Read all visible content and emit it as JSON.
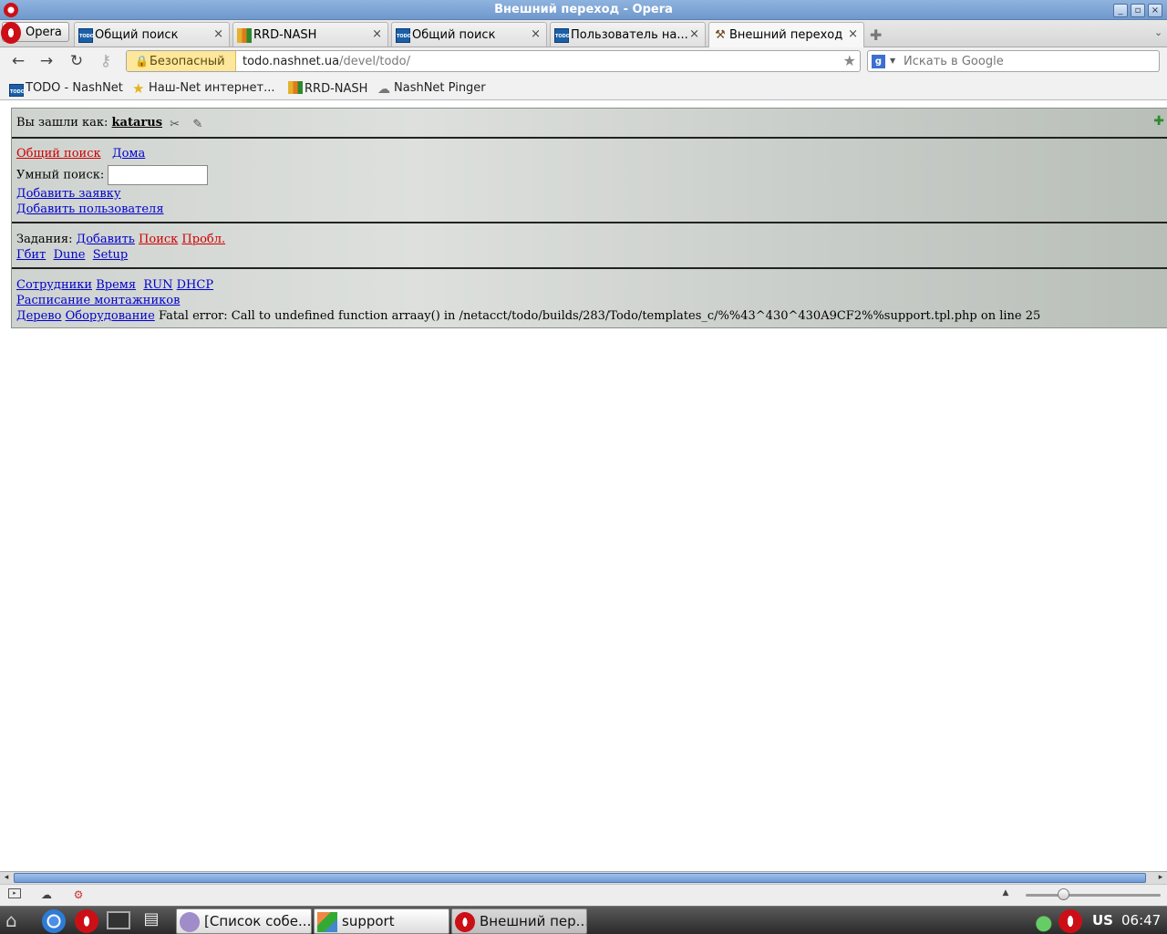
{
  "window": {
    "title": "Внешний переход - Opera"
  },
  "tabbar": {
    "menu_label": "Opera",
    "tabs": [
      {
        "label": "Общий поиск",
        "icon": "todo-favicon"
      },
      {
        "label": "RRD-NASH",
        "icon": "rrd-favicon"
      },
      {
        "label": "Общий поиск",
        "icon": "todo-favicon"
      },
      {
        "label": "Пользователь на...",
        "icon": "todo-favicon"
      },
      {
        "label": "Внешний переход",
        "icon": "hammer-favicon",
        "active": true
      }
    ],
    "close_glyph": "×"
  },
  "navbar": {
    "security_label": "Безопасный",
    "url_host": "todo.nashnet.ua",
    "url_path": "/devel/todo/",
    "search_placeholder": "Искать в Google"
  },
  "bookmarks": [
    {
      "label": "TODO - NashNet"
    },
    {
      "label": "Наш-Net интернет..."
    },
    {
      "label": "RRD-NASH"
    },
    {
      "label": "NashNet Pinger"
    }
  ],
  "page": {
    "logged_in_prefix": "Вы зашли как:",
    "username": "katarus",
    "links_row1": {
      "general_search": "Общий поиск",
      "home": "Дома"
    },
    "smart_search_label": "Умный поиск:",
    "add_request": "Добавить заявку",
    "add_user": "Добавить пользователя",
    "tasks_label": "Задания:",
    "tasks_add": "Добавить",
    "tasks_search": "Поиск",
    "tasks_problems": "Пробл.",
    "row_gbit": "Гбит",
    "row_dune": "Dune",
    "row_setup": "Setup",
    "staff": "Сотрудники",
    "time": "Время",
    "run": "RUN",
    "dhcp": "DHCP",
    "schedule": "Расписание монтажников",
    "tree": "Дерево",
    "equipment": "Оборудование",
    "error_text": "Fatal error: Call to undefined function arraay() in /netacct/todo/builds/283/Todo/templates_c/%%43^430^430A9CF2%%support.tpl.php on line 25"
  },
  "taskbar": {
    "items": [
      {
        "label": "[Список собе..."
      },
      {
        "label": "support"
      },
      {
        "label": "Внешний пер..."
      }
    ],
    "keyboard_layout": "US",
    "clock": "06:47"
  },
  "colors": {
    "link": "#0000cc",
    "visited_link": "#cc0000",
    "titlebar": "#7ba3d6",
    "security_badge": "#fce79a"
  }
}
